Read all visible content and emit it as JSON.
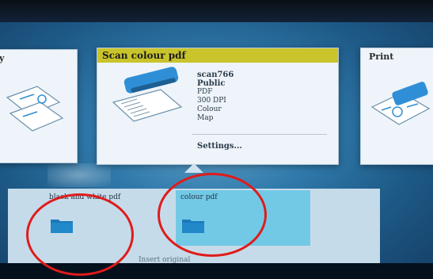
{
  "scan_card": {
    "header": "Scan  colour pdf",
    "name": "scan766",
    "owner": "Public",
    "format": "PDF",
    "resolution": "300 DPI",
    "color_mode": "Colour",
    "destination": "Map",
    "settings_label": "Settings..."
  },
  "print_card": {
    "header": "Print"
  },
  "left_card": {
    "header": "y"
  },
  "folders": [
    {
      "label": "black and white pdf"
    },
    {
      "label": "colour pdf"
    }
  ],
  "footer": {
    "hint": "Insert original"
  },
  "colors": {
    "header_accent": "#c9c42b",
    "selected_tile": "#72c9e6",
    "folder": "#1a79b8",
    "annotation_ring": "#e01b1b"
  }
}
